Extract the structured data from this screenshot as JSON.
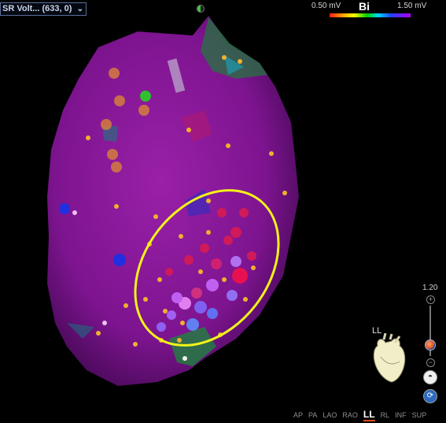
{
  "map_selector": {
    "label": "SR Volt... (633, 0)",
    "icon": "chevron-down-icon"
  },
  "color_scale": {
    "min_label": "0.50 mV",
    "max_label": "1.50 mV",
    "mode": "Bi",
    "colors": [
      "#ff1a1a",
      "#ffa000",
      "#ffff00",
      "#00d000",
      "#00d8ff",
      "#2040ff",
      "#b000ff"
    ]
  },
  "zoom": {
    "value_label": "1.20",
    "plus": "+",
    "minus": "−"
  },
  "view_controls": {
    "orientation_label": "LL"
  },
  "views": [
    {
      "label": "AP",
      "active": false
    },
    {
      "label": "PA",
      "active": false
    },
    {
      "label": "LAO",
      "active": false
    },
    {
      "label": "RAO",
      "active": false
    },
    {
      "label": "LL",
      "active": true
    },
    {
      "label": "RL",
      "active": false
    },
    {
      "label": "INF",
      "active": false
    },
    {
      "label": "SUP",
      "active": false
    }
  ],
  "colors": {
    "map_surface": "#8a1aa2",
    "highlight_ellipse": "#f2f21a",
    "accent": "#e04a1a"
  }
}
